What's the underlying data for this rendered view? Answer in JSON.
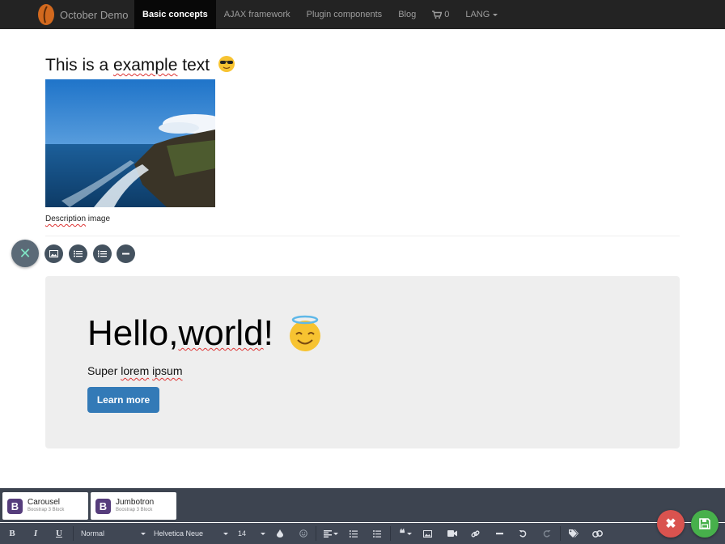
{
  "navbar": {
    "brand": "October Demo",
    "items": [
      {
        "label": "Basic concepts",
        "active": true
      },
      {
        "label": "AJAX framework"
      },
      {
        "label": "Plugin components"
      },
      {
        "label": "Blog"
      }
    ],
    "cart_count": "0",
    "lang_label": "LANG"
  },
  "content": {
    "heading_prefix": "This is a ",
    "heading_misspelled": "example",
    "heading_suffix": " text",
    "heading_emoji_icon": "sunglasses-emoji-icon",
    "caption_misspelled": "Description",
    "caption_suffix": " image",
    "mini_buttons": [
      "image-icon",
      "bulleted-list-icon",
      "numbered-list-icon",
      "horizontal-rule-icon"
    ]
  },
  "jumbotron": {
    "title_prefix": "Hello, ",
    "title_misspelled": "world",
    "title_suffix": "!",
    "title_emoji_icon": "smiling-face-with-halo-icon",
    "sub_prefix": "Super ",
    "sub_word1": "lorem",
    "sub_space": " ",
    "sub_word2": "ipsum",
    "button_label": "Learn more"
  },
  "blocks": [
    {
      "name": "Carousel",
      "subtitle": "Boostrap 3 Block"
    },
    {
      "name": "Jumbotron",
      "subtitle": "Boostrap 3 Block"
    }
  ],
  "toolbar": {
    "bold": "B",
    "italic": "I",
    "underline": "U",
    "format_value": "Normal",
    "font_value": "Helvetica Neue",
    "size_value": "14"
  },
  "colors": {
    "navbar_bg": "#232323",
    "primary": "#337ab7",
    "toolbar_bg": "#404754",
    "cancel": "#d9534f",
    "save": "#47b04b"
  }
}
